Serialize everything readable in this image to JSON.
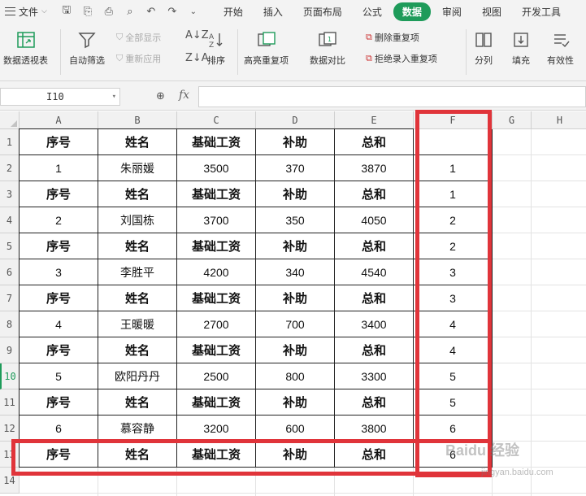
{
  "menubar": {
    "file_label": "文件",
    "tabs": [
      {
        "label": "开始",
        "active": false
      },
      {
        "label": "插入",
        "active": false
      },
      {
        "label": "页面布局",
        "active": false
      },
      {
        "label": "公式",
        "active": false
      },
      {
        "label": "数据",
        "active": true
      },
      {
        "label": "审阅",
        "active": false
      },
      {
        "label": "视图",
        "active": false
      },
      {
        "label": "开发工具",
        "active": false
      }
    ]
  },
  "ribbon": {
    "pivot": "数据透视表",
    "autofilter": "自动筛选",
    "show_all": "全部显示",
    "reapply": "重新应用",
    "sort": "排序",
    "highlight_dup": "高亮重复项",
    "compare": "数据对比",
    "remove_dup": "删除重复项",
    "reject_dup": "拒绝录入重复项",
    "split": "分列",
    "fill": "填充",
    "validity": "有效性"
  },
  "formula_bar": {
    "cell_ref": "I10",
    "fx": "fx",
    "value": ""
  },
  "grid": {
    "columns": [
      "A",
      "B",
      "C",
      "D",
      "E",
      "F",
      "G",
      "H"
    ],
    "rows": [
      "1",
      "2",
      "3",
      "4",
      "5",
      "6",
      "7",
      "8",
      "9",
      "10",
      "11",
      "12",
      "13",
      "14"
    ],
    "selected_row": "10",
    "header_row": [
      "序号",
      "姓名",
      "基础工资",
      "补助",
      "总和"
    ],
    "cells": {
      "r1": [
        "序号",
        "姓名",
        "基础工资",
        "补助",
        "总和",
        ""
      ],
      "r2": [
        "1",
        "朱丽媛",
        "3500",
        "370",
        "3870",
        "1"
      ],
      "r3": [
        "序号",
        "姓名",
        "基础工资",
        "补助",
        "总和",
        "1"
      ],
      "r4": [
        "2",
        "刘国栋",
        "3700",
        "350",
        "4050",
        "2"
      ],
      "r5": [
        "序号",
        "姓名",
        "基础工资",
        "补助",
        "总和",
        "2"
      ],
      "r6": [
        "3",
        "李胜平",
        "4200",
        "340",
        "4540",
        "3"
      ],
      "r7": [
        "序号",
        "姓名",
        "基础工资",
        "补助",
        "总和",
        "3"
      ],
      "r8": [
        "4",
        "王暖暖",
        "2700",
        "700",
        "3400",
        "4"
      ],
      "r9": [
        "序号",
        "姓名",
        "基础工资",
        "补助",
        "总和",
        "4"
      ],
      "r10": [
        "5",
        "欧阳丹丹",
        "2500",
        "800",
        "3300",
        "5"
      ],
      "r11": [
        "序号",
        "姓名",
        "基础工资",
        "补助",
        "总和",
        "5"
      ],
      "r12": [
        "6",
        "慕容静",
        "3200",
        "600",
        "3800",
        "6"
      ],
      "r13": [
        "序号",
        "姓名",
        "基础工资",
        "补助",
        "总和",
        "6"
      ]
    }
  },
  "annotation_color": "#e0343a",
  "accent_color": "#1e9b5a",
  "watermark": {
    "main": "Baidu 经验",
    "sub": "jingyan.baidu.com"
  }
}
